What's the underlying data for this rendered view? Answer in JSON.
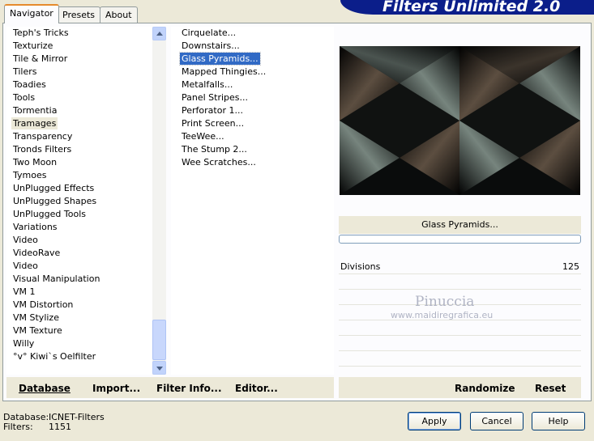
{
  "banner": {
    "title": "Filters Unlimited 2.0"
  },
  "tabs": [
    "Navigator",
    "Presets",
    "About"
  ],
  "categories": [
    "Teph's Tricks",
    "Texturize",
    "Tile & Mirror",
    "Tilers",
    "Toadies",
    "Tools",
    "Tormentia",
    "Tramages",
    "Transparency",
    "Tronds Filters",
    "Two Moon",
    "Tymoes",
    "UnPlugged Effects",
    "UnPlugged Shapes",
    "UnPlugged Tools",
    "Variations",
    "Video",
    "VideoRave",
    "Video",
    "Visual Manipulation",
    "VM 1",
    "VM Distortion",
    "VM Stylize",
    "VM Texture",
    "Willy",
    "°v° Kiwi`s Oelfilter"
  ],
  "selected_category": "Tramages",
  "filters": [
    "Cirquelate...",
    "Downstairs...",
    "Glass Pyramids...",
    "Mapped Thingies...",
    "Metalfalls...",
    "Panel Stripes...",
    "Perforator 1...",
    "Print Screen...",
    "TeeWee...",
    "The Stump 2...",
    "Wee Scratches..."
  ],
  "selected_filter": "Glass Pyramids...",
  "left_toolbar": {
    "database": "Database",
    "import": "Import...",
    "filter_info": "Filter Info...",
    "editor": "Editor..."
  },
  "right_toolbar": {
    "randomize": "Randomize",
    "reset": "Reset"
  },
  "current_filter": "Glass Pyramids...",
  "params": [
    {
      "label": "Divisions",
      "value": "125"
    }
  ],
  "watermark": {
    "name": "Pinuccia",
    "site": "www.maidiregrafica.eu"
  },
  "status": {
    "database_label": "Database:",
    "database_value": "ICNET-Filters",
    "filters_label": "Filters:",
    "filters_value": "1151"
  },
  "buttons": {
    "apply": "Apply",
    "cancel": "Cancel",
    "help": "Help"
  },
  "colors": {
    "banner": "#0b1e8a",
    "selection": "#316ac5",
    "tab_highlight": "#e68b2c"
  }
}
